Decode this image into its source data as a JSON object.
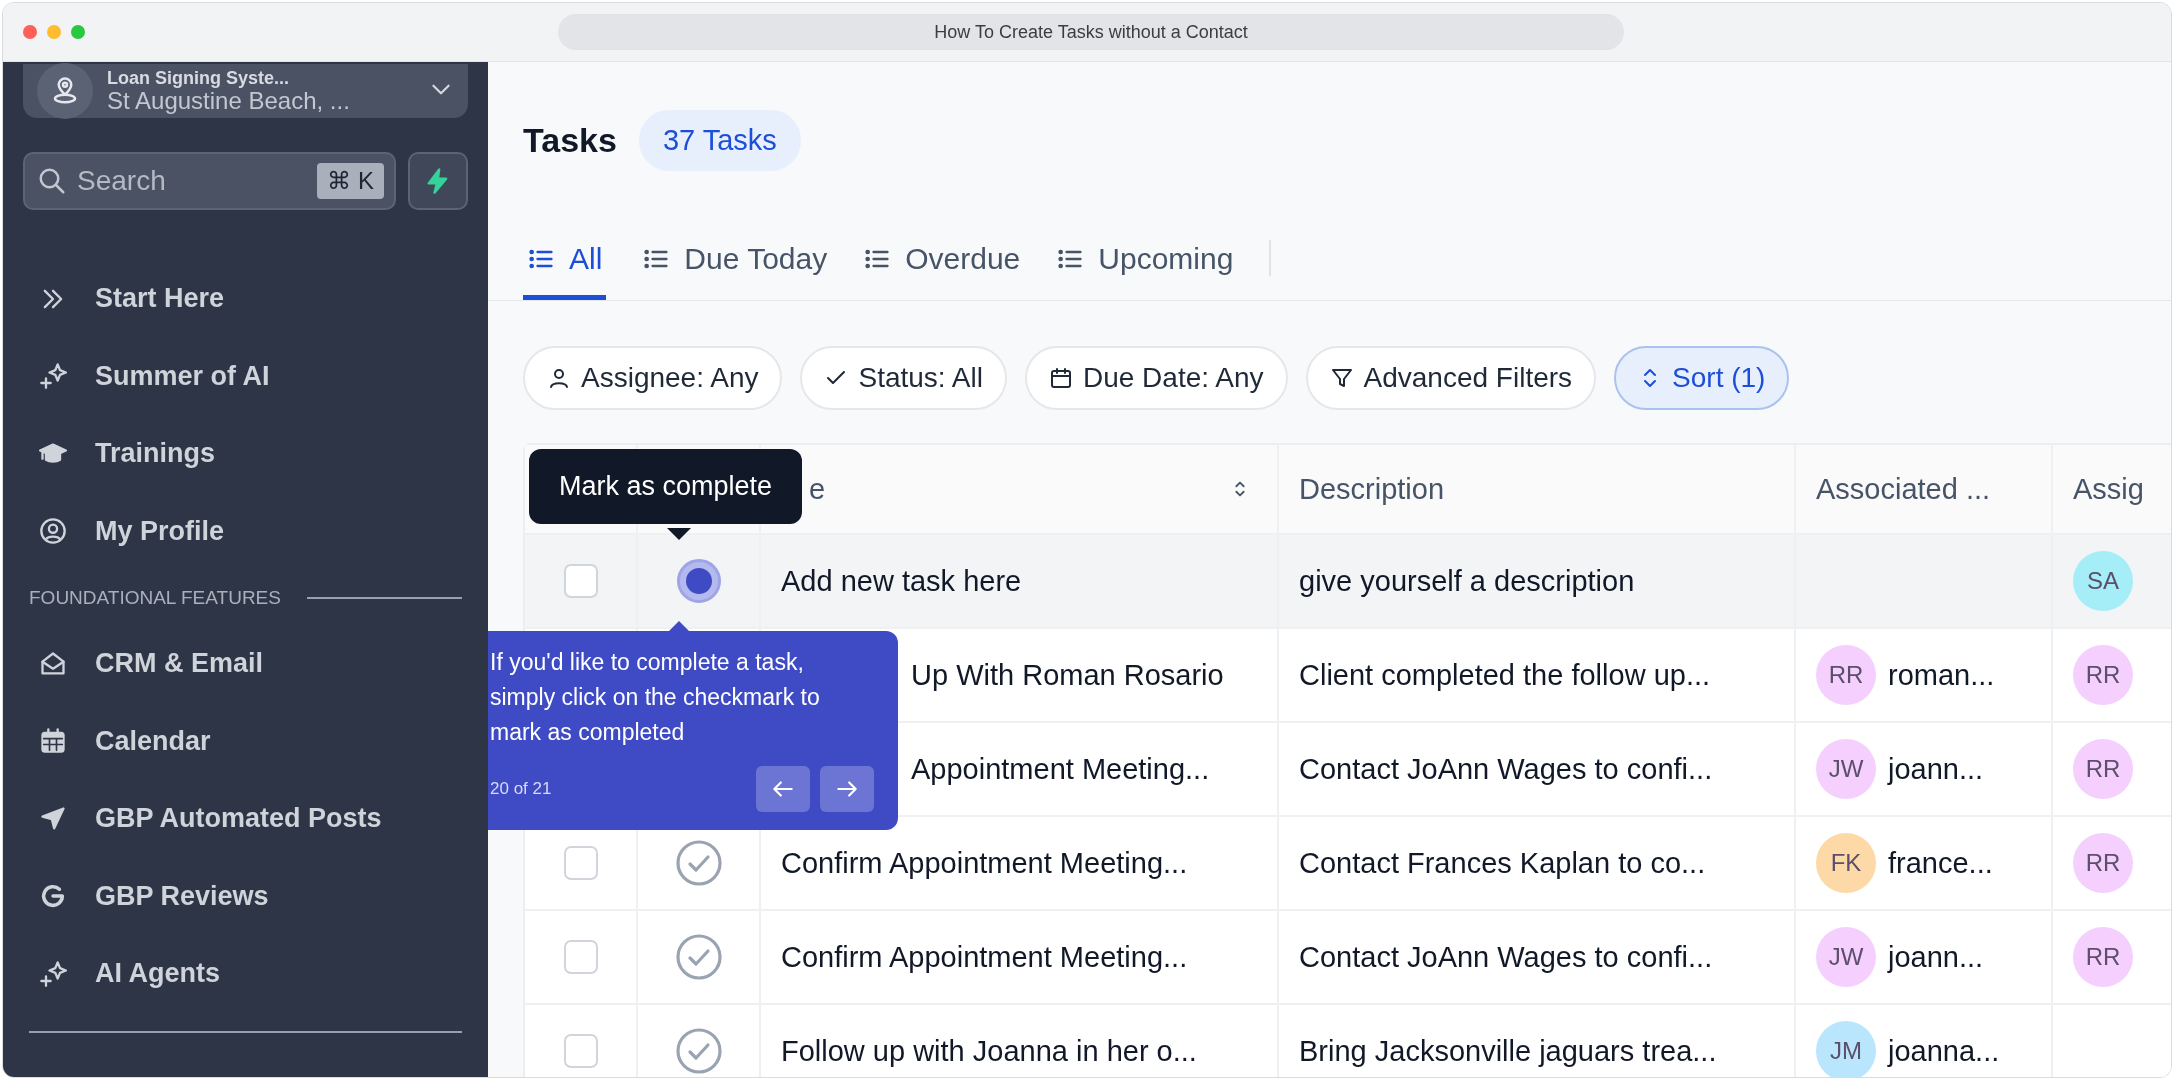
{
  "window": {
    "title": "How To Create Tasks without a Contact"
  },
  "sidebar": {
    "account": {
      "name": "Loan Signing Syste...",
      "location": "St Augustine Beach, ..."
    },
    "search": {
      "placeholder": "Search",
      "shortcut": "⌘ K"
    },
    "items": [
      {
        "label": "Start Here"
      },
      {
        "label": "Summer of AI"
      },
      {
        "label": "Trainings"
      },
      {
        "label": "My Profile"
      }
    ],
    "section": "FOUNDATIONAL FEATURES",
    "section_items": [
      {
        "label": "CRM & Email"
      },
      {
        "label": "Calendar"
      },
      {
        "label": "GBP Automated Posts"
      },
      {
        "label": "GBP Reviews"
      },
      {
        "label": "AI Agents"
      }
    ]
  },
  "header": {
    "title": "Tasks",
    "count": "37 Tasks"
  },
  "tabs": [
    {
      "label": "All",
      "selected": true
    },
    {
      "label": "Due Today",
      "selected": false
    },
    {
      "label": "Overdue",
      "selected": false
    },
    {
      "label": "Upcoming",
      "selected": false
    }
  ],
  "filters": [
    {
      "label": "Assignee: Any",
      "active": false
    },
    {
      "label": "Status: All",
      "active": false
    },
    {
      "label": "Due Date: Any",
      "active": false
    },
    {
      "label": "Advanced Filters",
      "active": false
    },
    {
      "label": "Sort (1)",
      "active": true
    }
  ],
  "table": {
    "columns": [
      {
        "label": "e"
      },
      {
        "label": "Description"
      },
      {
        "label": "Associated ..."
      },
      {
        "label": "Assig"
      }
    ],
    "rows": [
      {
        "name": "Add new task here",
        "description": "give yourself a description",
        "hovered": true,
        "covered": false,
        "assignee": {
          "initials": "SA",
          "color": "#a5eef8"
        }
      },
      {
        "name": "Up With Roman Rosario",
        "description": "Client completed the follow up...",
        "hovered": false,
        "covered": true,
        "contact": {
          "initials": "RR",
          "name": "roman...",
          "color": "#f5d0fe"
        },
        "assignee": {
          "initials": "RR",
          "color": "#f5d0fe"
        }
      },
      {
        "name": "Appointment Meeting...",
        "description": "Contact JoAnn Wages to confi...",
        "hovered": false,
        "covered": true,
        "contact": {
          "initials": "JW",
          "name": "joann...",
          "color": "#f5d0fe"
        },
        "assignee": {
          "initials": "RR",
          "color": "#f5d0fe"
        }
      },
      {
        "name": "Confirm Appointment Meeting...",
        "description": "Contact Frances Kaplan to co...",
        "hovered": false,
        "covered": false,
        "contact": {
          "initials": "FK",
          "name": "france...",
          "color": "#fcd9a6"
        },
        "assignee": {
          "initials": "RR",
          "color": "#f5d0fe"
        }
      },
      {
        "name": "Confirm Appointment Meeting...",
        "description": "Contact JoAnn Wages to confi...",
        "hovered": false,
        "covered": false,
        "contact": {
          "initials": "JW",
          "name": "joann...",
          "color": "#f5d0fe"
        },
        "assignee": {
          "initials": "RR",
          "color": "#f5d0fe"
        }
      },
      {
        "name": "Follow up with Joanna in her o...",
        "description": "Bring Jacksonville jaguars trea...",
        "hovered": false,
        "covered": false,
        "contact": {
          "initials": "JM",
          "name": "joanna...",
          "color": "#bae6fd"
        }
      }
    ]
  },
  "tooltip": {
    "text": "Mark as complete"
  },
  "tour": {
    "text": "If you'd like to complete a task, simply click on the checkmark to mark as completed",
    "progress": "20 of 21"
  }
}
